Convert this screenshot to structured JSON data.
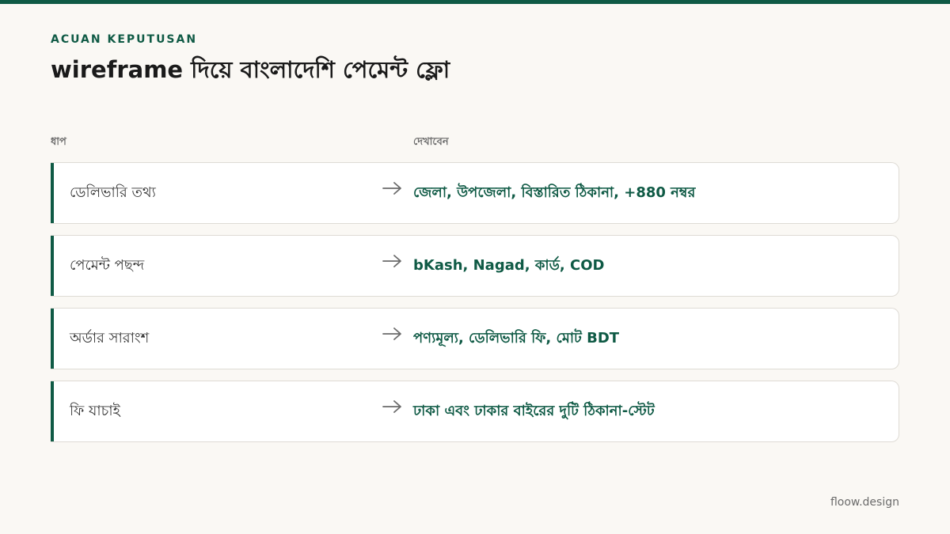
{
  "header": {
    "eyebrow": "ACUAN KEPUTUSAN",
    "title": "wireframe দিয়ে বাংলাদেশি পেমেন্ট ফ্লো"
  },
  "columns": {
    "step": "ধাপ",
    "show": "দেখাবেন"
  },
  "rows": [
    {
      "step": "ডেলিভারি তথ্য",
      "show": "জেলা, উপজেলা, বিস্তারিত ঠিকানা, +880 নম্বর"
    },
    {
      "step": "পেমেন্ট পছন্দ",
      "show": "bKash, Nagad, কার্ড, COD"
    },
    {
      "step": "অর্ডার সারাংশ",
      "show": "পণ্যমূল্য, ডেলিভারি ফি, মোট BDT"
    },
    {
      "step": "ফি যাচাই",
      "show": "ঢাকা এবং ঢাকার বাইরের দুটি ঠিকানা-স্টেট"
    }
  ],
  "footer": {
    "brand": "floow.design"
  },
  "colors": {
    "accent": "#0f5a45",
    "background": "#faf8f4"
  }
}
